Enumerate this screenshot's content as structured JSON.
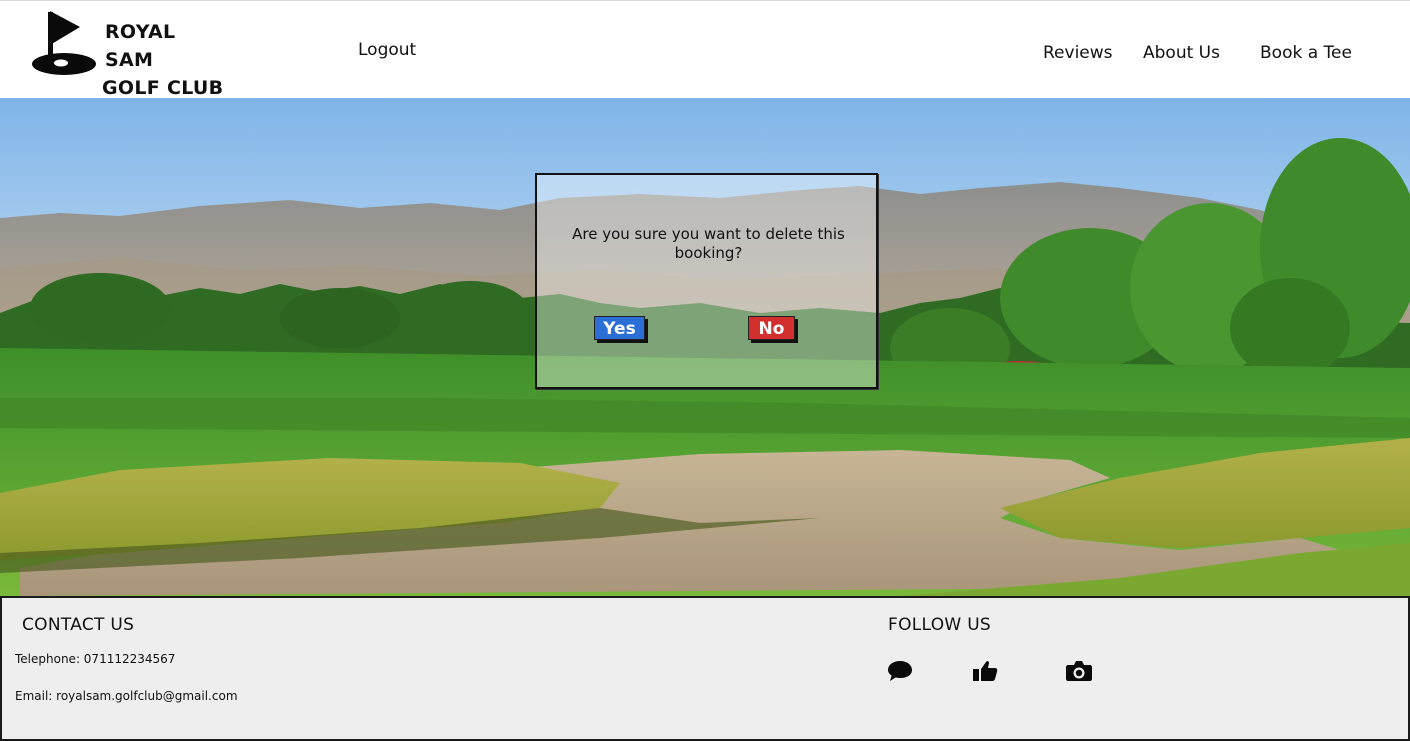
{
  "header": {
    "logo": {
      "line1": "ROYAL SAM",
      "line2": "GOLF CLUB",
      "icon": "golf-flag-icon"
    },
    "nav": {
      "logout": "Logout",
      "reviews": "Reviews",
      "about": "About Us",
      "book": "Book a Tee"
    }
  },
  "modal": {
    "message": "Are you sure you want to delete this booking?",
    "yes_label": "Yes",
    "no_label": "No",
    "yes_color": "#2b6fd6",
    "no_color": "#d22f2f"
  },
  "footer": {
    "contact": {
      "heading": "CONTACT US",
      "telephone": "Telephone: 071112234567",
      "email": "Email: royalsam.golfclub@gmail.com"
    },
    "follow": {
      "heading": "FOLLOW US",
      "icons": [
        "chat-bubble-icon",
        "thumbs-up-icon",
        "camera-icon"
      ]
    }
  }
}
